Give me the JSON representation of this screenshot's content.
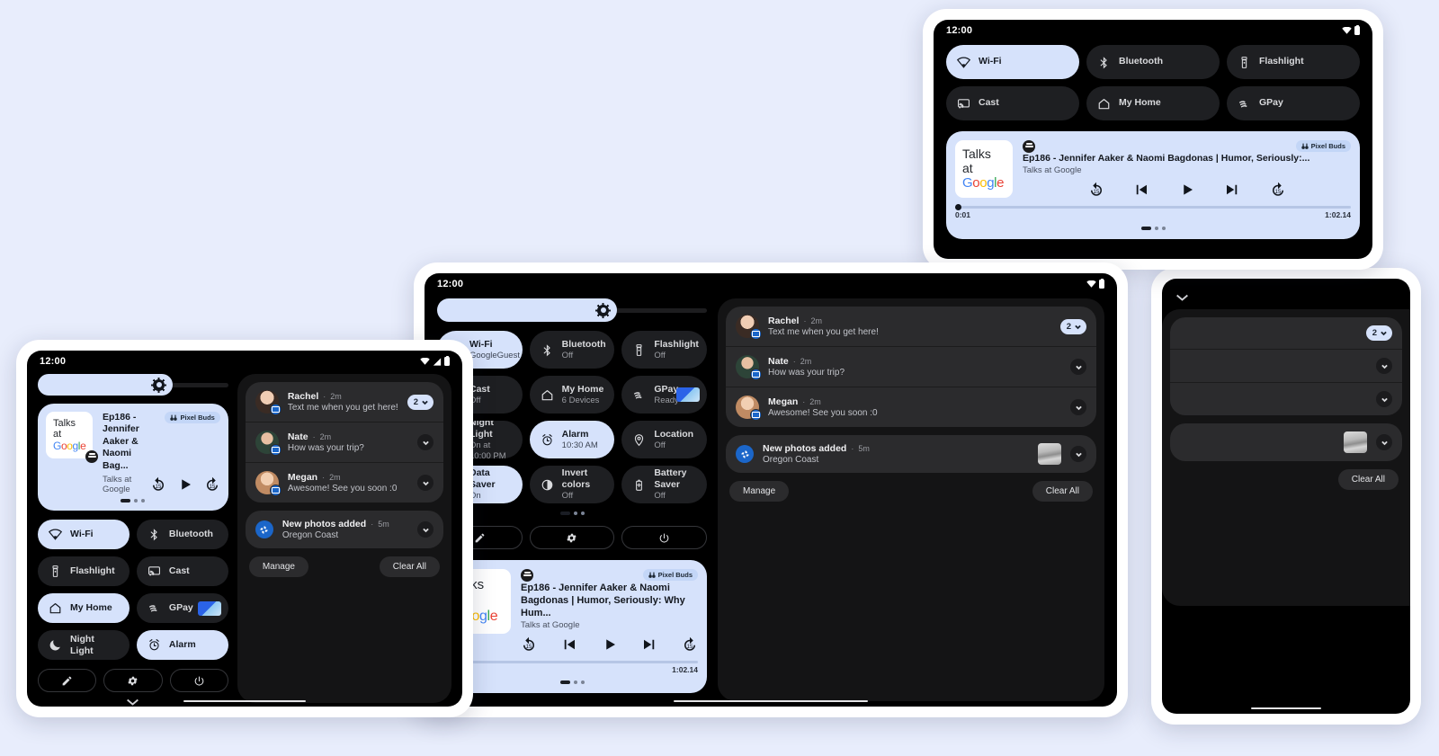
{
  "background_color": "#e8edfc",
  "status": {
    "time": "12:00",
    "icons": [
      "wifi-icon",
      "signal-icon",
      "battery-icon"
    ]
  },
  "brightness": {
    "name": "brightness-slider",
    "icon": "brightness-sun-icon",
    "level_percent": 72
  },
  "quick_settings": {
    "phone_tiles": [
      {
        "label": "Wi-Fi",
        "sub": "",
        "icon": "wifi-icon",
        "on": true
      },
      {
        "label": "Bluetooth",
        "sub": "",
        "icon": "bluetooth-icon",
        "on": false
      },
      {
        "label": "Flashlight",
        "sub": "",
        "icon": "flashlight-icon",
        "on": false
      },
      {
        "label": "Cast",
        "sub": "",
        "icon": "cast-icon",
        "on": false
      },
      {
        "label": "My Home",
        "sub": "",
        "icon": "home-icon",
        "on": true
      },
      {
        "label": "GPay",
        "sub": "",
        "icon": "gpay-icon",
        "on": false,
        "card": true
      },
      {
        "label": "Night Light",
        "sub": "",
        "icon": "moon-icon",
        "on": false
      },
      {
        "label": "Alarm",
        "sub": "",
        "icon": "alarm-icon",
        "on": true
      }
    ],
    "top_tiles": [
      {
        "label": "Wi-Fi",
        "icon": "wifi-icon",
        "on": true
      },
      {
        "label": "Bluetooth",
        "icon": "bluetooth-icon",
        "on": false
      },
      {
        "label": "Flashlight",
        "icon": "flashlight-icon",
        "on": false
      },
      {
        "label": "Cast",
        "icon": "cast-icon",
        "on": false
      },
      {
        "label": "My Home",
        "icon": "home-icon",
        "on": false
      },
      {
        "label": "GPay",
        "icon": "gpay-icon",
        "on": false
      }
    ],
    "tablet_tiles": [
      {
        "label": "Wi-Fi",
        "sub": "GoogleGuest",
        "icon": "wifi-icon",
        "on": true
      },
      {
        "label": "Bluetooth",
        "sub": "Off",
        "icon": "bluetooth-icon",
        "on": false
      },
      {
        "label": "Flashlight",
        "sub": "Off",
        "icon": "flashlight-icon",
        "on": false
      },
      {
        "label": "Cast",
        "sub": "Off",
        "icon": "cast-icon",
        "on": false
      },
      {
        "label": "My Home",
        "sub": "6 Devices",
        "icon": "home-icon",
        "on": false
      },
      {
        "label": "GPay",
        "sub": "Ready",
        "icon": "gpay-icon",
        "on": false,
        "card": true
      },
      {
        "label": "Night Light",
        "sub": "On at 10:00 PM",
        "icon": "moon-icon",
        "on": false
      },
      {
        "label": "Alarm",
        "sub": "10:30 AM",
        "icon": "alarm-icon",
        "on": true
      },
      {
        "label": "Location",
        "sub": "Off",
        "icon": "location-icon",
        "on": false
      },
      {
        "label": "Data Saver",
        "sub": "On",
        "icon": "data-saver-icon",
        "on": true
      },
      {
        "label": "Invert colors",
        "sub": "Off",
        "icon": "invert-icon",
        "on": false
      },
      {
        "label": "Battery Saver",
        "sub": "Off",
        "icon": "battery-saver-icon",
        "on": false
      }
    ],
    "page_dots": 3,
    "page_active": 0
  },
  "media": {
    "album_line1": "Talks",
    "album_line2": "at",
    "album_brand": "Google",
    "app_icon": "podcast-app-icon",
    "output_chip": {
      "label": "Pixel Buds",
      "icon": "earbuds-icon"
    },
    "title_full": "Ep186 - Jennifer Aaker & Naomi Bagdonas | Humor, Seriously:...",
    "title_tablet": "Ep186 - Jennifer Aaker & Naomi Bagdonas | Humor, Seriously: Why Hum...",
    "title_phone": "Ep186 - Jennifer Aaker & Naomi Bag...",
    "artist": "Talks at Google",
    "elapsed": "0:01",
    "duration": "1:02.14",
    "progress_percent": 1,
    "controls": [
      "replay-15-icon",
      "previous-track-icon",
      "play-icon",
      "next-track-icon",
      "forward-15-icon"
    ],
    "controls_phone": [
      "replay-15-icon",
      "play-icon",
      "forward-15-icon"
    ],
    "page_dots": 3,
    "page_active": 0
  },
  "notifications": {
    "items": [
      {
        "name": "Rachel",
        "separator": "·",
        "time": "2m",
        "body": "Text me when you get here!",
        "icon": "avatar",
        "action": "count",
        "count": "2"
      },
      {
        "name": "Nate",
        "separator": "·",
        "time": "2m",
        "body": "How was your trip?",
        "icon": "avatar",
        "action": "chevron"
      },
      {
        "name": "Megan",
        "separator": "·",
        "time": "2m",
        "body": "Awesome! See you soon :0",
        "icon": "avatar",
        "action": "chevron"
      }
    ],
    "photos": {
      "name": "New photos added",
      "separator": "·",
      "time": "5m",
      "body": "Oregon Coast",
      "icon": "google-photos-icon",
      "thumbnail": "photo-thumbnail",
      "action": "chevron"
    },
    "manage_label": "Manage",
    "clear_all_label": "Clear All"
  },
  "footer_buttons": [
    {
      "icon": "edit-pencil-icon",
      "name": "edit-tiles-button"
    },
    {
      "icon": "gear-icon",
      "name": "settings-button"
    },
    {
      "icon": "power-icon",
      "name": "power-button"
    }
  ],
  "collapse_icon": "chevron-down-icon",
  "colors": {
    "accent_light": "#d6e2fb",
    "surface_dark": "#1e1f22",
    "notif_surface": "#2b2b2d",
    "screen_bg": "#000000",
    "badge_blue": "#1b66c9"
  }
}
